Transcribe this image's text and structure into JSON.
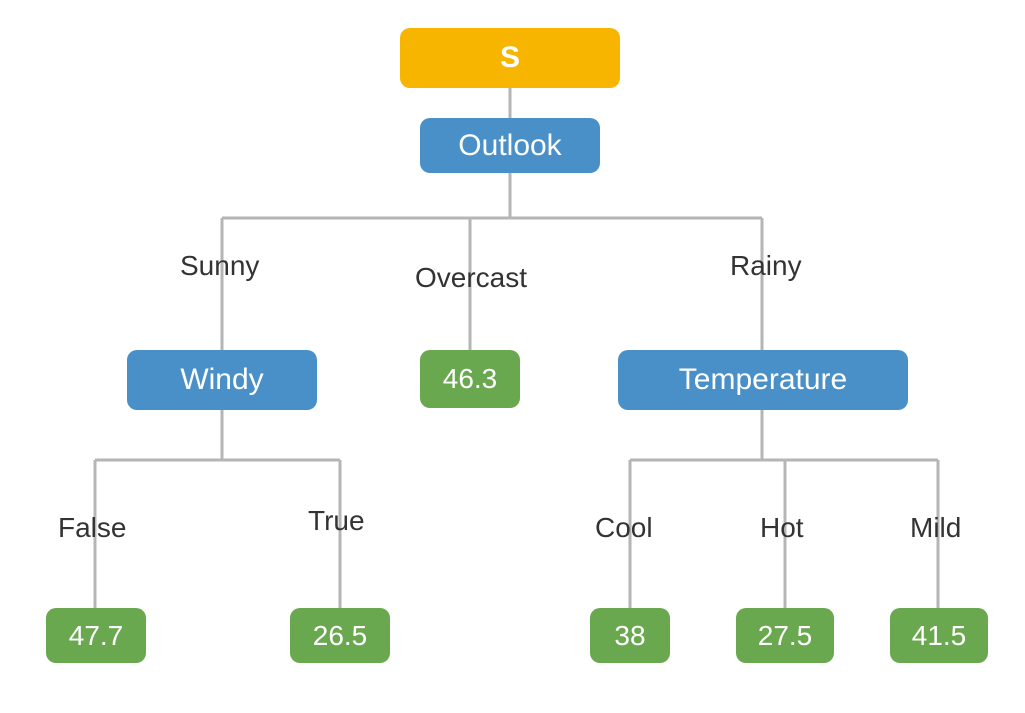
{
  "root": {
    "label": "S"
  },
  "outlook": {
    "label": "Outlook",
    "branches": {
      "sunny": {
        "label": "Sunny"
      },
      "overcast": {
        "label": "Overcast"
      },
      "rainy": {
        "label": "Rainy"
      }
    }
  },
  "windy": {
    "label": "Windy",
    "branches": {
      "false": {
        "label": "False"
      },
      "true": {
        "label": "True"
      }
    }
  },
  "temperature": {
    "label": "Temperature",
    "branches": {
      "cool": {
        "label": "Cool"
      },
      "hot": {
        "label": "Hot"
      },
      "mild": {
        "label": "Mild"
      }
    }
  },
  "leaves": {
    "overcast": {
      "value": "46.3"
    },
    "windy_false": {
      "value": "47.7"
    },
    "windy_true": {
      "value": "26.5"
    },
    "temp_cool": {
      "value": "38"
    },
    "temp_hot": {
      "value": "27.5"
    },
    "temp_mild": {
      "value": "41.5"
    }
  },
  "colors": {
    "root": "#f7b500",
    "attr": "#4a90c8",
    "leaf": "#6aa84f",
    "edge": "#b5b5b5",
    "text": "#333333"
  }
}
